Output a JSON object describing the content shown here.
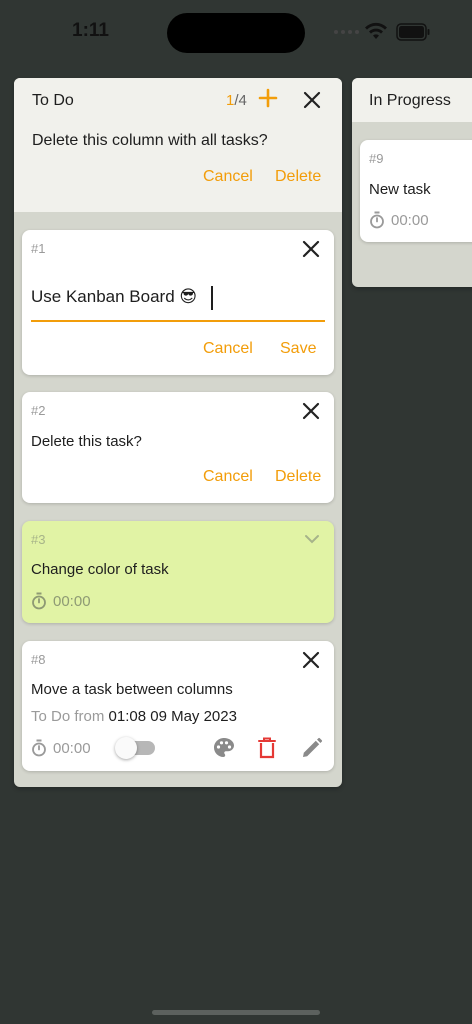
{
  "status_bar": {
    "time": "1:11"
  },
  "columns": [
    {
      "title": "To Do",
      "count_current": "1",
      "count_total": "/4",
      "confirm": {
        "text": "Delete this column with all tasks?",
        "cancel": "Cancel",
        "delete": "Delete"
      },
      "cards": [
        {
          "number": "#1",
          "editing": true,
          "input_value": "Use Kanban Board 😎",
          "cancel": "Cancel",
          "save": "Save"
        },
        {
          "number": "#2",
          "title": "Delete this task?",
          "cancel": "Cancel",
          "delete": "Delete"
        },
        {
          "number": "#3",
          "title": "Change color of task",
          "timer": "00:00",
          "color": "#e1f3a5"
        },
        {
          "number": "#8",
          "title": "Move a task between columns",
          "from_label": "To Do",
          "from_word": "from",
          "from_date": "01:08 09 May 2023",
          "timer": "00:00"
        }
      ]
    },
    {
      "title": "In Progress",
      "cards": [
        {
          "number": "#9",
          "title": "New task",
          "timer": "00:00"
        }
      ]
    }
  ],
  "colors": {
    "accent": "#f29d0a",
    "delete_red": "#e53935",
    "background": "#303633",
    "column_body": "#d4d6cd",
    "column_header": "#f1f1ec"
  },
  "icons": {
    "add": "plus-icon",
    "close": "close-icon",
    "expand": "chevron-down-icon",
    "timer": "timer-icon",
    "palette": "palette-icon",
    "delete": "trash-icon",
    "edit": "pencil-icon"
  }
}
